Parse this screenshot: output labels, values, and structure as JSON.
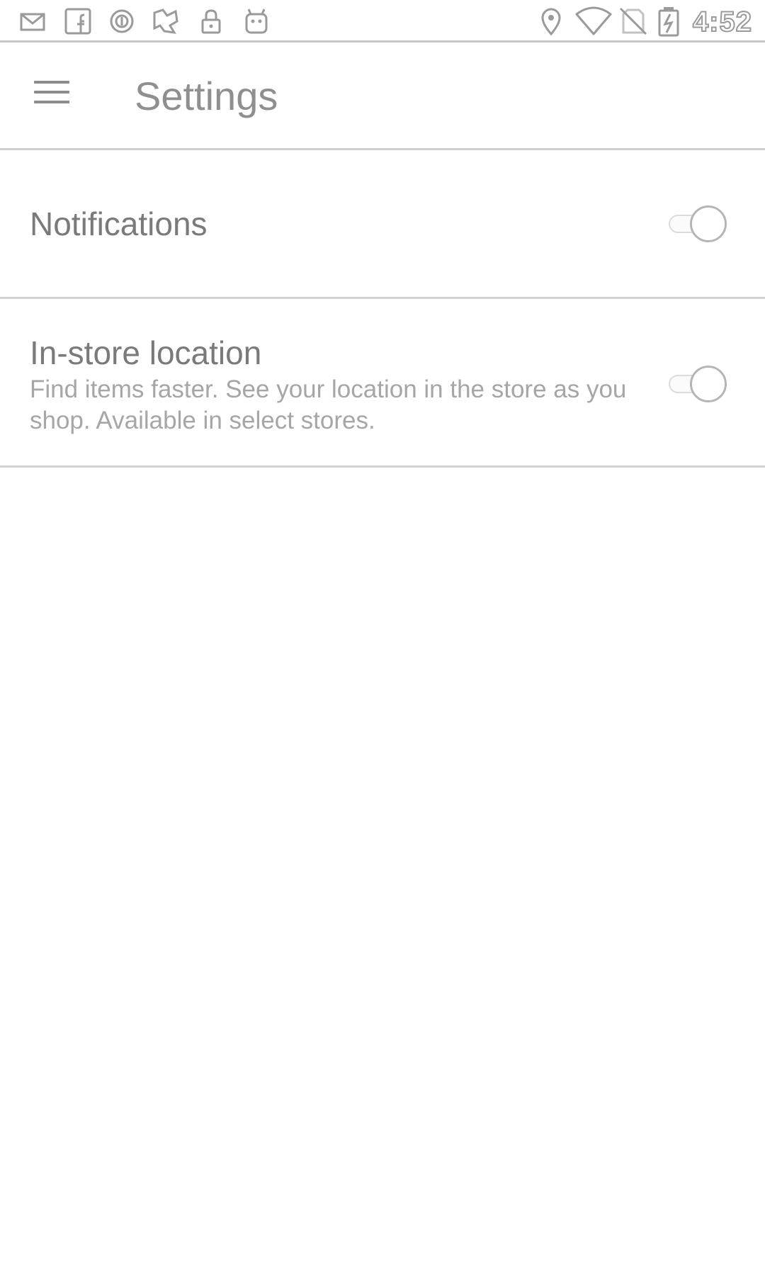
{
  "status_bar": {
    "left_icons": [
      "mail-icon",
      "facebook-icon",
      "circle-app-icon",
      "puzzle-app-icon",
      "lock-icon",
      "android-icon"
    ],
    "right_icons": [
      "location-icon",
      "wifi-icon",
      "no-sim-icon",
      "battery-charging-icon"
    ],
    "time": "4:52"
  },
  "app_bar": {
    "menu_icon": "hamburger-menu-icon",
    "title": "Settings"
  },
  "settings": [
    {
      "title": "Notifications",
      "summary": "",
      "enabled": false
    },
    {
      "title": "In-store location",
      "summary": "Find items faster. See your location in the store as you shop. Available in select stores.",
      "enabled": false
    }
  ],
  "colors": {
    "title_text": "#8f8f8f",
    "row_title_text": "#7a7a7a",
    "summary_text": "#a6a6a6",
    "divider": "#d2d2d2"
  }
}
